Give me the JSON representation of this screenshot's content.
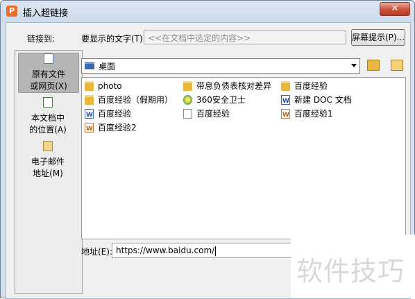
{
  "window": {
    "title": "插入超链接",
    "close_label": "✕"
  },
  "header": {
    "link_to_label": "链接到:",
    "display_text_label": "要显示的文字(T):",
    "display_text_value": "<<在文档中选定的内容>>",
    "screentip_button": "屏幕提示(P)..."
  },
  "sidebar": {
    "items": [
      {
        "line1": "原有文件",
        "line2": "或网页(X)",
        "selected": true
      },
      {
        "line1": "本文档中",
        "line2": "的位置(A)",
        "selected": false
      },
      {
        "line1": "电子邮件",
        "line2": "地址(M)",
        "selected": false
      }
    ]
  },
  "lookin": {
    "value": "桌面"
  },
  "files": [
    {
      "name": "photo",
      "icon": "folder-icon"
    },
    {
      "name": "带息负债表核对差异",
      "icon": "folder-icon"
    },
    {
      "name": "百度经验",
      "icon": "folder-icon"
    },
    {
      "name": "百度经验（假期用）",
      "icon": "folder-icon"
    },
    {
      "name": "360安全卫士",
      "icon": "360-icon"
    },
    {
      "name": "新建 DOC 文档",
      "icon": "word-doc-icon"
    },
    {
      "name": "百度经验",
      "icon": "word-doc-icon"
    },
    {
      "name": "百度经验",
      "icon": "text-doc-icon"
    },
    {
      "name": "百度经验1",
      "icon": "wps-doc-icon"
    },
    {
      "name": "百度经验2",
      "icon": "wps-doc-icon"
    }
  ],
  "address": {
    "label": "地址(E):",
    "value": "https://www.baidu.com/"
  },
  "watermark": {
    "text": "软件技巧"
  }
}
